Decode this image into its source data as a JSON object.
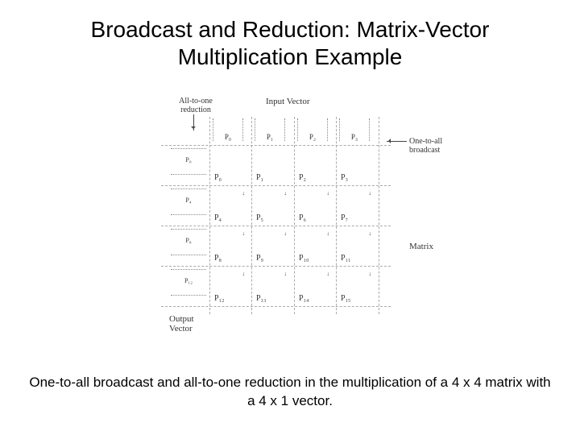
{
  "title": "Broadcast and Reduction: Matrix-Vector Multiplication Example",
  "caption": "One-to-all broadcast and all-to-one reduction in the multiplication of a 4 x 4 matrix with a 4 x 1 vector.",
  "labels": {
    "reduction": "All-to-one reduction",
    "input": "Input Vector",
    "broadcast": "One-to-all broadcast",
    "matrix": "Matrix",
    "output": "Output\nVector"
  },
  "top_header": [
    "P₀",
    "P₁",
    "P₂",
    "P₃"
  ],
  "left_header": [
    "P₀",
    "P₄",
    "P₈",
    "P₁₂"
  ],
  "grid": [
    [
      "P₀",
      "P₁",
      "P₂",
      "P₃"
    ],
    [
      "P₄",
      "P₅",
      "P₆",
      "P₇"
    ],
    [
      "P₈",
      "P₉",
      "P₁₀",
      "P₁₁"
    ],
    [
      "P₁₂",
      "P₁₃",
      "P₁₄",
      "P₁₅"
    ]
  ],
  "chart_data": {
    "type": "diagram",
    "description": "4x4 processor grid illustrating one-to-all broadcast of input vector across top row and all-to-one reduction into output vector down left column",
    "processors_rows": 4,
    "processors_cols": 4,
    "processor_ids": [
      [
        0,
        1,
        2,
        3
      ],
      [
        4,
        5,
        6,
        7
      ],
      [
        8,
        9,
        10,
        11
      ],
      [
        12,
        13,
        14,
        15
      ]
    ],
    "input_vector_holders": [
      0,
      1,
      2,
      3
    ],
    "output_vector_holders": [
      0,
      4,
      8,
      12
    ],
    "broadcast_direction": "row-wise (one-to-all)",
    "reduction_direction": "column-wise (all-to-one)",
    "matrix_dims": "4x4",
    "vector_dims": "4x1"
  }
}
